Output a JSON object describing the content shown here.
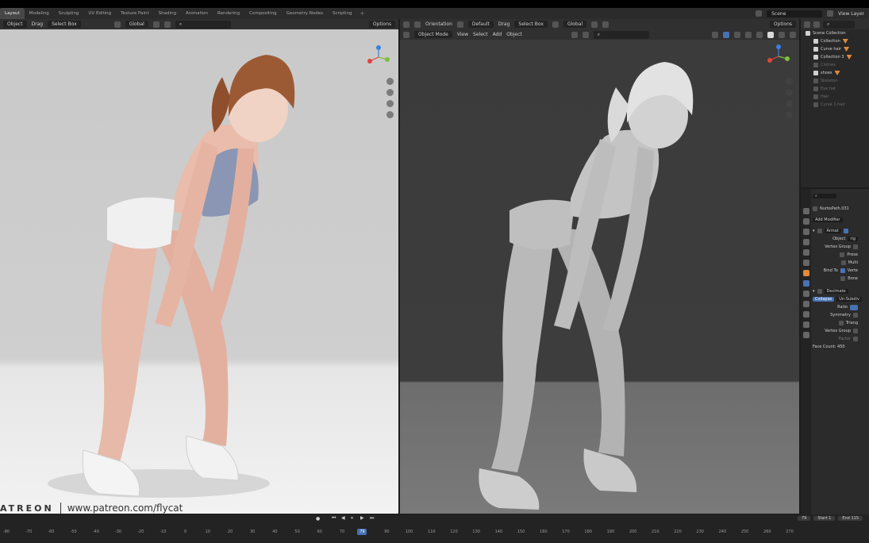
{
  "workspace": {
    "tabs": [
      "Layout",
      "Modeling",
      "Sculpting",
      "UV Editing",
      "Texture Paint",
      "Shading",
      "Animation",
      "Rendering",
      "Compositing",
      "Geometry Nodes",
      "Scripting"
    ],
    "active_index": 0,
    "add": "+",
    "scene": "Scene",
    "view_layer": "View Layer"
  },
  "left_header": {
    "object": "Object",
    "drag": "Drag",
    "select": "Select Box",
    "orientation": "Global",
    "options": "Options"
  },
  "right_header": {
    "orientation_label": "Orientation",
    "orientation": "Default",
    "drag": "Drag",
    "select": "Select Box",
    "transform": "Global",
    "options": "Options",
    "mode": "Object Mode",
    "menu": [
      "View",
      "Select",
      "Add",
      "Object"
    ]
  },
  "watermark": {
    "brand": "ATREON",
    "url": "www.patreon.com/flycat"
  },
  "outliner": {
    "root": "Scene Collection",
    "items": [
      {
        "label": "Collection",
        "dim": false
      },
      {
        "label": "Curve hair",
        "dim": false
      },
      {
        "label": "Collection 3",
        "dim": false
      },
      {
        "label": "Clothes",
        "dim": true
      },
      {
        "label": "shoes",
        "dim": false
      },
      {
        "label": "Skeleton",
        "dim": true
      },
      {
        "label": "Eye hat",
        "dim": true
      },
      {
        "label": "Hair",
        "dim": true
      },
      {
        "label": "Curve 1 hair",
        "dim": true
      }
    ]
  },
  "properties": {
    "object_name": "NurbsPath.031",
    "add_modifier": "Add Modifier",
    "armature": {
      "name": "Armat",
      "object_label": "Object",
      "object_value": "rig",
      "vertex_group_label": "Vertex Group",
      "options": [
        "Prese",
        "Multi"
      ],
      "bind_to_label": "Bind To",
      "bind_options": [
        "Verte",
        "Bone"
      ]
    },
    "decimate": {
      "name": "Decimate",
      "mode_active": "Collapse",
      "mode_other": "Un-Subdiv",
      "ratio_label": "Ratio",
      "symmetry_label": "Symmetry",
      "triangulate": "Triang",
      "vertex_group_label": "Vertex Group",
      "factor_label": "Factor",
      "face_count": "Face Count: 450"
    }
  },
  "timeline": {
    "ticks": [
      "-80",
      "-70",
      "-60",
      "-50",
      "-40",
      "-30",
      "-20",
      "-10",
      "0",
      "10",
      "20",
      "30",
      "40",
      "50",
      "60",
      "70",
      "80",
      "90",
      "100",
      "110",
      "120",
      "130",
      "140",
      "150",
      "160",
      "170",
      "180",
      "190",
      "200",
      "210",
      "220",
      "230",
      "240",
      "250",
      "260",
      "270"
    ],
    "current_frame": "79",
    "frame_field": "79",
    "start_label": "Start",
    "start": "1",
    "end_label": "End",
    "end": "115"
  },
  "colors": {
    "accent": "#4772b3",
    "gizmo_x": "#e0443a",
    "gizmo_y": "#7fbf3a",
    "gizmo_z": "#3a7fe0",
    "collection_icon": "#e08a3c"
  }
}
